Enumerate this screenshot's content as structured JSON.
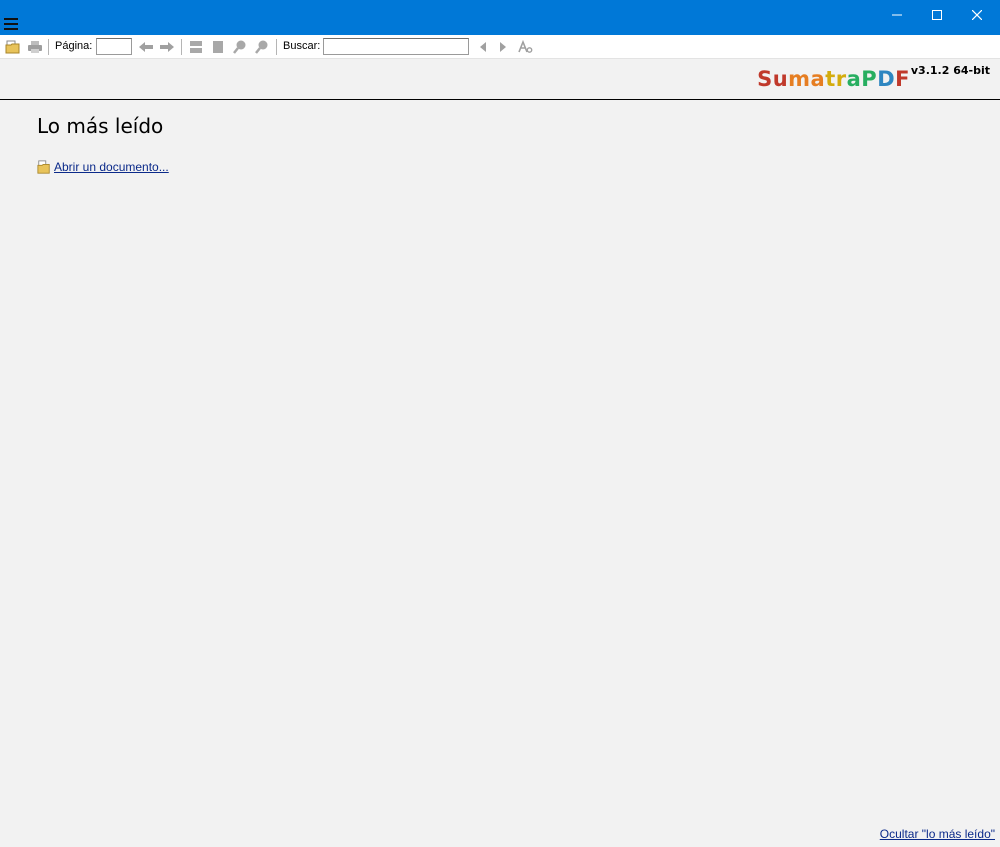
{
  "titlebar": {
    "background": "#0078d7"
  },
  "toolbar": {
    "page_label": "Página:",
    "page_value": "",
    "search_label": "Buscar:",
    "search_value": ""
  },
  "brand": {
    "name_letters": [
      {
        "ch": "S",
        "color": "#c0392b"
      },
      {
        "ch": "u",
        "color": "#c0392b"
      },
      {
        "ch": "m",
        "color": "#e67e22"
      },
      {
        "ch": "a",
        "color": "#e67e22"
      },
      {
        "ch": "t",
        "color": "#d4ac0d"
      },
      {
        "ch": "r",
        "color": "#d4ac0d"
      },
      {
        "ch": "a",
        "color": "#27ae60"
      },
      {
        "ch": "P",
        "color": "#27ae60"
      },
      {
        "ch": "D",
        "color": "#2e86c1"
      },
      {
        "ch": "F",
        "color": "#c0392b"
      }
    ],
    "version": "v3.1.2 64-bit"
  },
  "main": {
    "heading": "Lo más leído",
    "open_document": "Abrir un documento...",
    "hide_link": "Ocultar \"lo más leído\""
  }
}
